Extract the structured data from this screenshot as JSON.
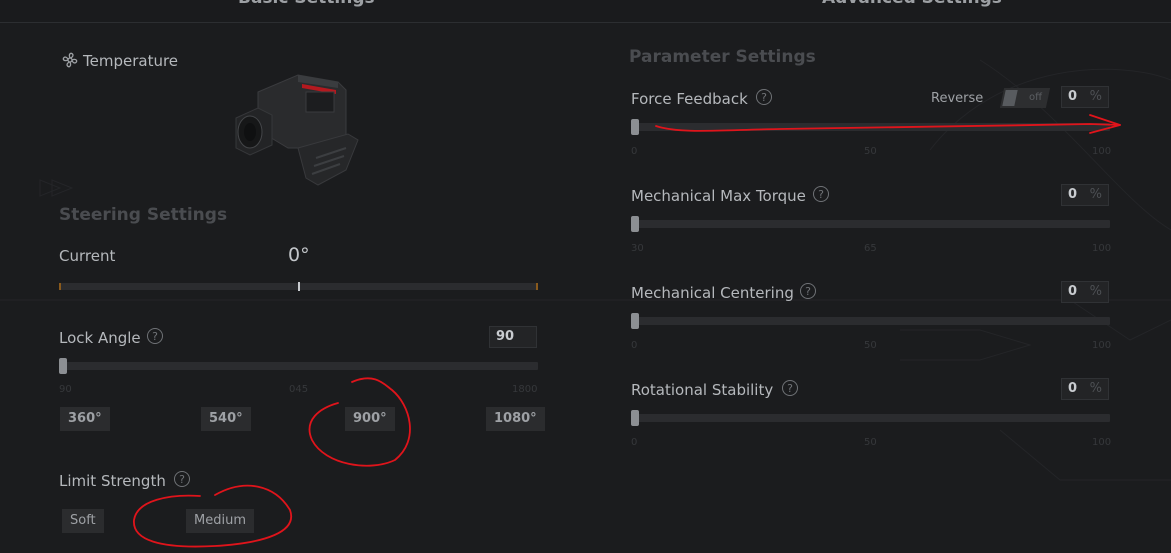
{
  "tabs": [
    {
      "label": "Basic Settings"
    },
    {
      "label": "Advanced Settings"
    }
  ],
  "device": {
    "temperature_label": "Temperature",
    "temperature_icon": "fan-icon"
  },
  "steering": {
    "section_title": "Steering Settings",
    "current": {
      "label": "Current",
      "value": "0°",
      "position": 0.5
    },
    "lock_angle": {
      "label": "Lock Angle",
      "help": "?",
      "value": "90",
      "slider_fraction": 0.0,
      "ticks": [
        "90",
        "045",
        "1800"
      ],
      "presets": [
        "360°",
        "540°",
        "900°",
        "1080°"
      ]
    },
    "limit_strength": {
      "label": "Limit Strength",
      "help": "?",
      "options": [
        "Soft",
        "Medium"
      ]
    }
  },
  "params": {
    "section_title": "Parameter Settings",
    "force_feedback": {
      "label": "Force Feedback",
      "help": "?",
      "reverse_label": "Reverse",
      "reverse_state": "off",
      "value": "0",
      "unit": "%",
      "slider_fraction": 0.0,
      "ticks": [
        "0",
        "50",
        "100"
      ]
    },
    "max_torque": {
      "label": "Mechanical Max Torque",
      "help": "?",
      "value": "0",
      "unit": "%",
      "slider_fraction": 0.0,
      "ticks": [
        "30",
        "65",
        "100"
      ]
    },
    "centering": {
      "label": "Mechanical Centering",
      "help": "?",
      "value": "0",
      "unit": "%",
      "slider_fraction": 0.0,
      "ticks": [
        "0",
        "50",
        "100"
      ]
    },
    "stability": {
      "label": "Rotational Stability",
      "help": "?",
      "value": "0",
      "unit": "%",
      "slider_fraction": 0.0,
      "ticks": [
        "0",
        "50",
        "100"
      ]
    }
  },
  "colors": {
    "background": "#1b1c1e",
    "annotation": "#e0141b",
    "accent": "#b4191f"
  }
}
